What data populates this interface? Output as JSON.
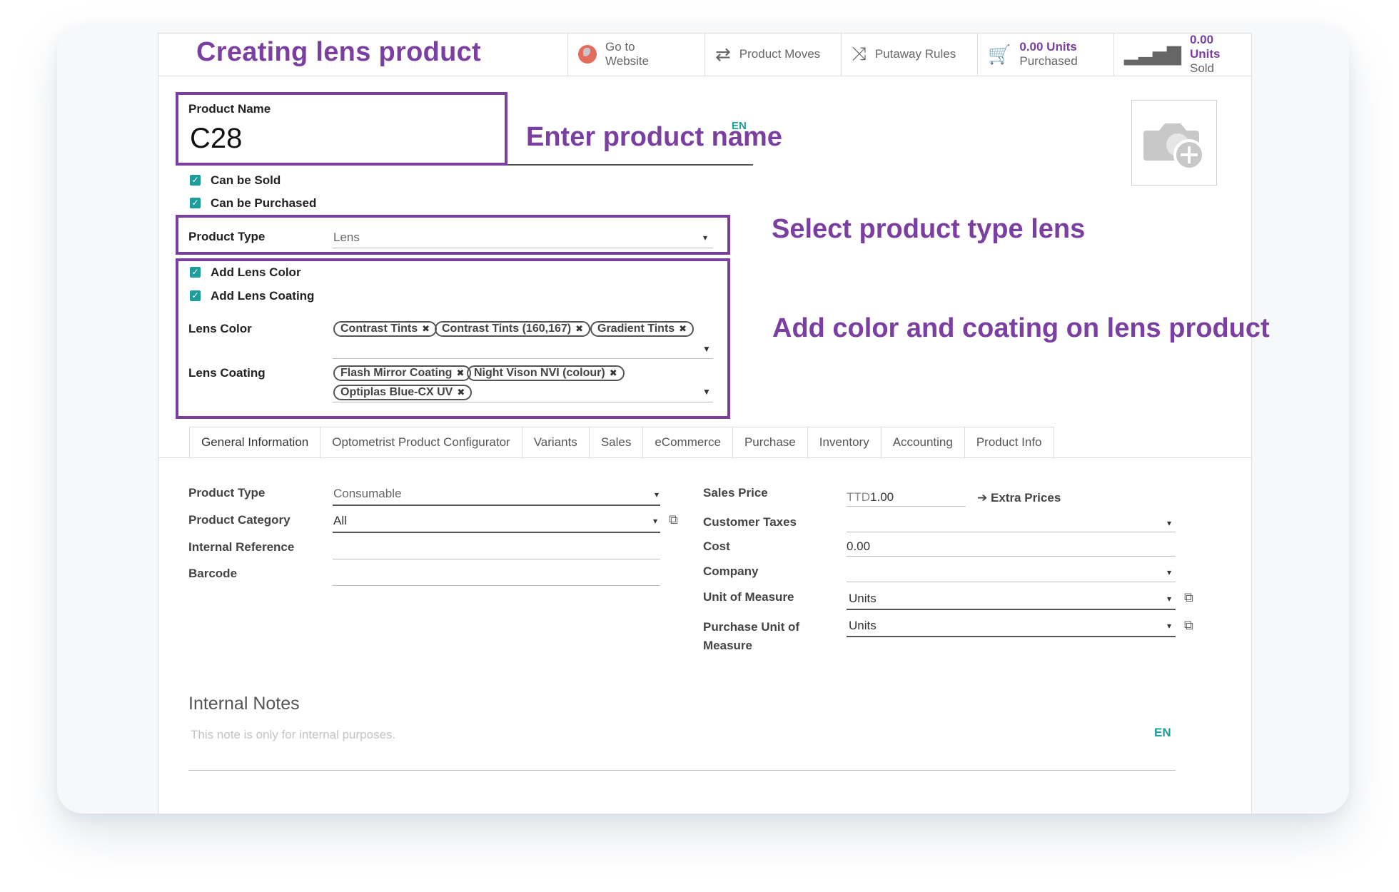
{
  "page_title": "Creating lens product",
  "smart_buttons": [
    {
      "line1": "Go to",
      "line2": "Website",
      "icon": "globe-icon"
    },
    {
      "label": "Product Moves",
      "icon": "arrows-exchange-icon"
    },
    {
      "label": "Putaway Rules",
      "icon": "shuffle-icon"
    },
    {
      "value": "0.00 Units",
      "label": "Purchased",
      "icon": "cart-icon"
    },
    {
      "value": "0.00 Units",
      "label": "Sold",
      "icon": "signal-bars-icon"
    }
  ],
  "product_name": {
    "label": "Product Name",
    "value": "C28",
    "lang": "EN"
  },
  "annotations": {
    "name": "Enter product name",
    "type": "Select product type lens",
    "color_coating": "Add color and coating on lens product"
  },
  "checkboxes": {
    "can_be_sold": "Can be Sold",
    "can_be_purchased": "Can be Purchased",
    "add_lens_color": "Add Lens Color",
    "add_lens_coating": "Add Lens Coating"
  },
  "product_type_top": {
    "label": "Product Type",
    "value": "Lens"
  },
  "lens_color": {
    "label": "Lens Color",
    "tags": [
      "Contrast Tints",
      "Contrast Tints (160,167)",
      "Gradient Tints"
    ]
  },
  "lens_coating": {
    "label": "Lens Coating",
    "tags": [
      "Flash Mirror Coating",
      "Night Vison NVI (colour)",
      "Optiplas Blue-CX UV"
    ]
  },
  "tabs": [
    "General Information",
    "Optometrist Product Configurator",
    "Variants",
    "Sales",
    "eCommerce",
    "Purchase",
    "Inventory",
    "Accounting",
    "Product Info"
  ],
  "general": {
    "product_type": {
      "label": "Product Type",
      "value": "Consumable"
    },
    "product_category": {
      "label": "Product Category",
      "value": "All"
    },
    "internal_reference": {
      "label": "Internal Reference",
      "value": ""
    },
    "barcode": {
      "label": "Barcode",
      "value": ""
    },
    "sales_price": {
      "label": "Sales Price",
      "currency": "TTD",
      "value": "1.00",
      "extra": "Extra Prices"
    },
    "customer_taxes": {
      "label": "Customer Taxes",
      "value": ""
    },
    "cost": {
      "label": "Cost",
      "value": "0.00"
    },
    "company": {
      "label": "Company",
      "value": ""
    },
    "uom": {
      "label": "Unit of Measure",
      "value": "Units"
    },
    "purchase_uom": {
      "label_line1": "Purchase Unit of",
      "label_line2": "Measure",
      "value": "Units"
    }
  },
  "notes": {
    "title": "Internal Notes",
    "placeholder": "This note is only for internal purposes.",
    "lang": "EN"
  },
  "colors": {
    "accent": "#7a3fa0",
    "teal": "#1f9c9c"
  }
}
